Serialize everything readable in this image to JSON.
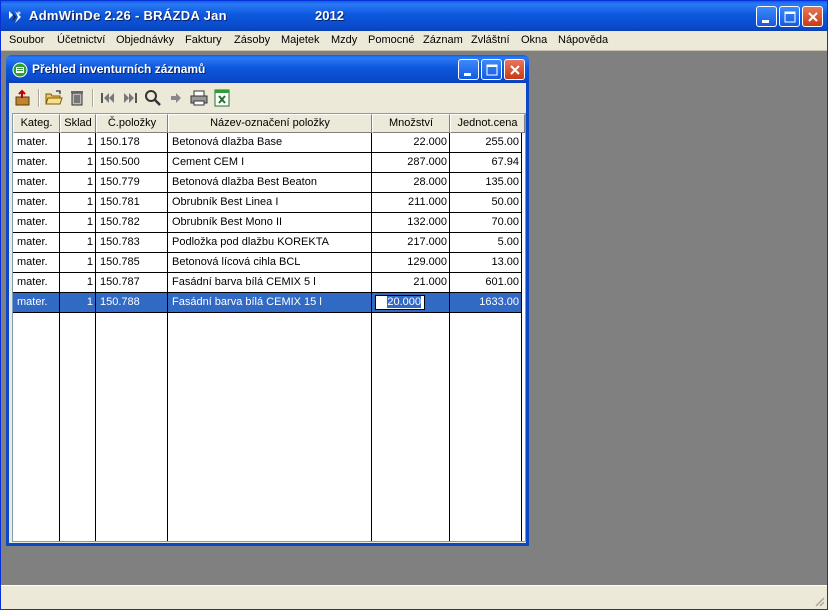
{
  "app": {
    "title": "AdmWinDe 2.26 - BRÁZDA Jan",
    "year": "2012"
  },
  "menu": [
    {
      "label": "Soubor"
    },
    {
      "label": "Účetnictví"
    },
    {
      "label": "Objednávky"
    },
    {
      "label": "Faktury"
    },
    {
      "label": "Zásoby"
    },
    {
      "label": "Majetek"
    },
    {
      "label": "Mzdy"
    },
    {
      "label": "Pomocné"
    },
    {
      "label": "Záznam"
    },
    {
      "label": "Zvláštní"
    },
    {
      "label": "Okna"
    },
    {
      "label": "Nápověda"
    }
  ],
  "window": {
    "title": "Přehled inventurních záznamů"
  },
  "toolbar": {
    "icons": [
      "export-icon",
      "open-folder-icon",
      "delete-icon",
      "first-record-icon",
      "last-record-icon",
      "search-icon",
      "next-icon",
      "print-icon",
      "excel-icon"
    ]
  },
  "table": {
    "columns": [
      "Kateg.",
      "Sklad",
      "Č.položky",
      "Název-označení položky",
      "Množství",
      "Jednot.cena"
    ],
    "rows": [
      {
        "kateg": "mater.",
        "sklad": "1",
        "cislo": "150.178",
        "nazev": "Betonová dlažba Base",
        "mnozstvi": "22.000",
        "cena": "255.00"
      },
      {
        "kateg": "mater.",
        "sklad": "1",
        "cislo": "150.500",
        "nazev": "Cement CEM I",
        "mnozstvi": "287.000",
        "cena": "67.94"
      },
      {
        "kateg": "mater.",
        "sklad": "1",
        "cislo": "150.779",
        "nazev": "Betonová dlažba Best Beaton",
        "mnozstvi": "28.000",
        "cena": "135.00"
      },
      {
        "kateg": "mater.",
        "sklad": "1",
        "cislo": "150.781",
        "nazev": "Obrubník Best Linea I",
        "mnozstvi": "211.000",
        "cena": "50.00"
      },
      {
        "kateg": "mater.",
        "sklad": "1",
        "cislo": "150.782",
        "nazev": "Obrubník Best Mono II",
        "mnozstvi": "132.000",
        "cena": "70.00"
      },
      {
        "kateg": "mater.",
        "sklad": "1",
        "cislo": "150.783",
        "nazev": "Podložka pod dlažbu KOREKTA",
        "mnozstvi": "217.000",
        "cena": "5.00"
      },
      {
        "kateg": "mater.",
        "sklad": "1",
        "cislo": "150.785",
        "nazev": "Betonová lícová cihla BCL",
        "mnozstvi": "129.000",
        "cena": "13.00"
      },
      {
        "kateg": "mater.",
        "sklad": "1",
        "cislo": "150.787",
        "nazev": "Fasádní barva bílá CEMIX 5 l",
        "mnozstvi": "21.000",
        "cena": "601.00"
      },
      {
        "kateg": "mater.",
        "sklad": "1",
        "cislo": "150.788",
        "nazev": "Fasádní barva bílá CEMIX 15 l",
        "mnozstvi": "20.000",
        "cena": "1633.00"
      }
    ],
    "selected_row": 8,
    "editing_value": "20.000"
  },
  "colors": {
    "titlebar": "#0a49c8",
    "selection": "#316ac5",
    "face": "#ece9d8",
    "desktop": "#808080"
  }
}
